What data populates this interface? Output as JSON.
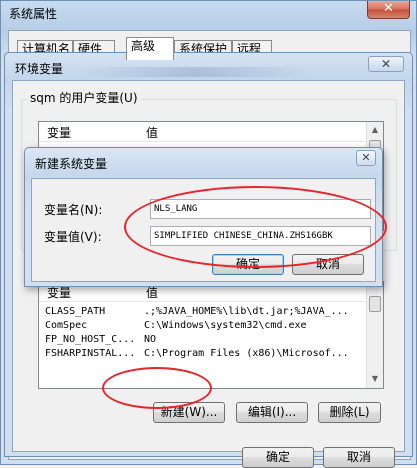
{
  "system_properties": {
    "title": "系统属性",
    "close_glyph": "✕",
    "tabs": [
      "计算机名",
      "硬件",
      "高级",
      "系统保护",
      "远程"
    ],
    "active_tab": "高级"
  },
  "env_dialog": {
    "title": "环境变量",
    "close_glyph": "✕",
    "user_group_label": "sqm 的用户变量(U)",
    "user_columns": [
      "变量",
      "值"
    ],
    "sys_columns": [
      "变量",
      "值"
    ],
    "system_rows": [
      {
        "name": "CLASS_PATH",
        "value": ".;%JAVA_HOME%\\lib\\dt.jar;%JAVA_..."
      },
      {
        "name": "ComSpec",
        "value": "C:\\Windows\\system32\\cmd.exe"
      },
      {
        "name": "FP_NO_HOST_C...",
        "value": "NO"
      },
      {
        "name": "FSHARPINSTAL...",
        "value": "C:\\Program Files (x86)\\Microsof..."
      }
    ],
    "buttons": {
      "new": "新建(W)...",
      "edit": "编辑(I)...",
      "delete": "删除(L)"
    },
    "ok": "确定",
    "cancel": "取消"
  },
  "new_var_dialog": {
    "title": "新建系统变量",
    "close_glyph": "✕",
    "name_label": "变量名(N):",
    "value_label": "变量值(V):",
    "name_value": "NLS_LANG",
    "value_value": "SIMPLIFIED CHINESE_CHINA.ZHS16GBK",
    "ok": "确定",
    "cancel": "取消"
  },
  "colors": {
    "annotation": "#e8252c",
    "window_frame": "#6f8fb4",
    "client": "#f0f0f0"
  }
}
